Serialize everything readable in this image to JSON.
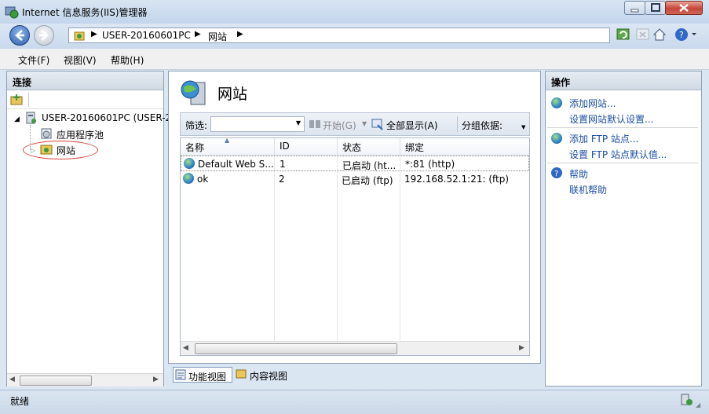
{
  "window": {
    "title": "Internet 信息服务(IIS)管理器"
  },
  "address": {
    "crumbs": [
      "USER-20160601PC",
      "网站"
    ],
    "separator": "▶"
  },
  "menu": {
    "items": [
      "文件(F)",
      "视图(V)",
      "帮助(H)"
    ]
  },
  "connections": {
    "header": "连接",
    "tree": {
      "server": "USER-20160601PC (USER-2",
      "app_pools": "应用程序池",
      "sites": "网站"
    }
  },
  "main": {
    "title": "网站",
    "filter": {
      "label": "筛选:",
      "start_label": "开始(G)",
      "show_all_label": "全部显示(A)",
      "group_by_label": "分组依据:"
    },
    "table": {
      "columns": [
        "名称",
        "ID",
        "状态",
        "绑定"
      ],
      "rows": [
        {
          "name": "Default Web S...",
          "id": "1",
          "status": "已启动 (ht...",
          "binding": "*:81 (http)"
        },
        {
          "name": "ok",
          "id": "2",
          "status": "已启动 (ftp)",
          "binding": "192.168.52.1:21: (ftp)"
        }
      ]
    },
    "view_tabs": {
      "features": "功能视图",
      "content": "内容视图"
    }
  },
  "actions": {
    "header": "操作",
    "groups": [
      [
        "添加网站...",
        "设置网站默认设置..."
      ],
      [
        "添加 FTP 站点...",
        "设置 FTP 站点默认值..."
      ],
      [
        "帮助",
        "联机帮助"
      ]
    ]
  },
  "status": {
    "text": "就绪"
  },
  "colors": {
    "accent": "#1c4fa5",
    "highlight_circle": "#d9443a"
  }
}
